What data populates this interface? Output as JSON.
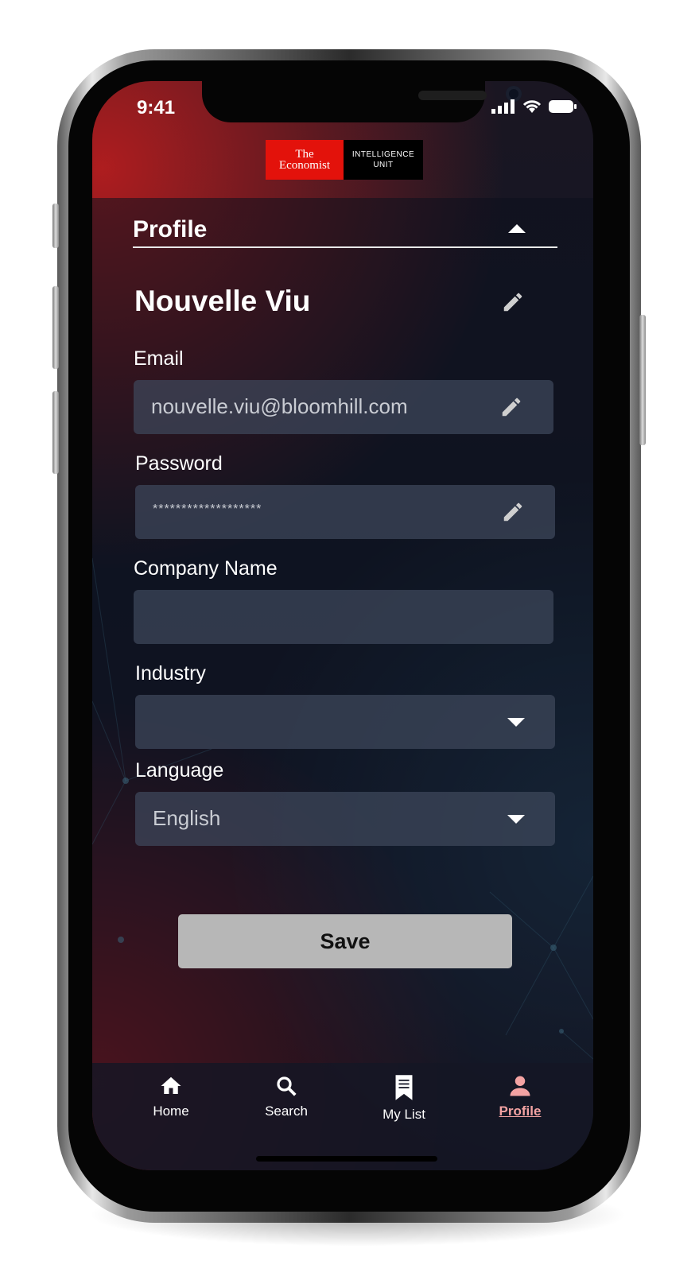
{
  "status_bar": {
    "time": "9:41"
  },
  "brand": {
    "line1": "The",
    "line2": "Economist",
    "eiu_line1": "INTELLIGENCE",
    "eiu_line2": "UNIT"
  },
  "profile": {
    "section_title": "Profile",
    "user_name": "Nouvelle Viu",
    "email_label": "Email",
    "email_value": "nouvelle.viu@bloomhill.com",
    "password_label": "Password",
    "password_value": "*******************",
    "company_label": "Company Name",
    "company_value": "",
    "industry_label": "Industry",
    "industry_value": "",
    "language_label": "Language",
    "language_value": "English",
    "save_label": "Save"
  },
  "tabs": [
    {
      "label": "Home",
      "icon": "home-icon"
    },
    {
      "label": "Search",
      "icon": "search-icon"
    },
    {
      "label": "My List",
      "icon": "bookmark-icon"
    },
    {
      "label": "Profile",
      "icon": "person-icon",
      "active": true
    }
  ],
  "colors": {
    "brand_red": "#e3120b",
    "active_tab": "#f4a3a3",
    "save_button": "#b7b7b7"
  }
}
